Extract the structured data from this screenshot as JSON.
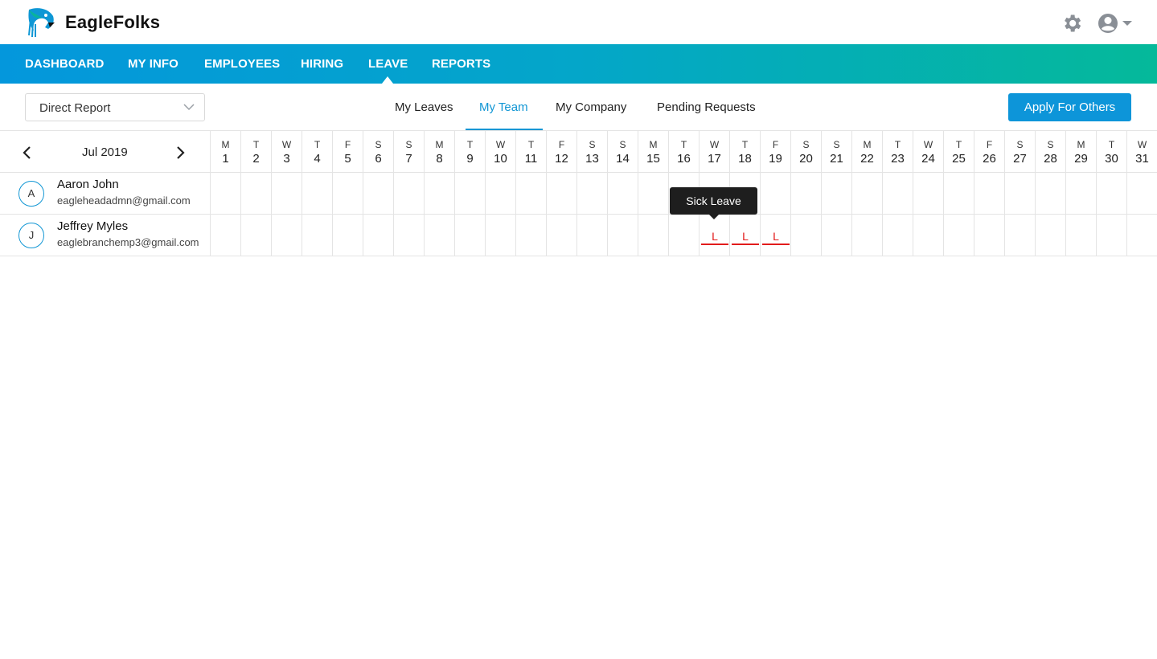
{
  "app": {
    "brand": "EagleFolks",
    "colors": {
      "accent": "#1196d4",
      "leave": "#e21b1b",
      "button": "#0d95d9"
    }
  },
  "header": {
    "icons": [
      "eagle-logo-icon",
      "gear-icon",
      "user-circle-icon",
      "caret-down-icon"
    ]
  },
  "nav": {
    "items": [
      {
        "label": "DASHBOARD"
      },
      {
        "label": "MY INFO"
      },
      {
        "label": "EMPLOYEES"
      },
      {
        "label": "HIRING"
      },
      {
        "label": "LEAVE",
        "active": true
      },
      {
        "label": "REPORTS"
      }
    ]
  },
  "filter": {
    "selected": "Direct Report"
  },
  "subtabs": {
    "items": [
      {
        "label": "My Leaves"
      },
      {
        "label": "My Team",
        "active": true
      },
      {
        "label": "My Company"
      },
      {
        "label": "Pending Requests"
      }
    ]
  },
  "actions": {
    "apply_label": "Apply For Others"
  },
  "calendar": {
    "month_label": "Jul 2019",
    "days": [
      {
        "letter": "M",
        "num": "1"
      },
      {
        "letter": "T",
        "num": "2"
      },
      {
        "letter": "W",
        "num": "3"
      },
      {
        "letter": "T",
        "num": "4"
      },
      {
        "letter": "F",
        "num": "5"
      },
      {
        "letter": "S",
        "num": "6"
      },
      {
        "letter": "S",
        "num": "7"
      },
      {
        "letter": "M",
        "num": "8"
      },
      {
        "letter": "T",
        "num": "9"
      },
      {
        "letter": "W",
        "num": "10"
      },
      {
        "letter": "T",
        "num": "11"
      },
      {
        "letter": "F",
        "num": "12"
      },
      {
        "letter": "S",
        "num": "13"
      },
      {
        "letter": "S",
        "num": "14"
      },
      {
        "letter": "M",
        "num": "15"
      },
      {
        "letter": "T",
        "num": "16"
      },
      {
        "letter": "W",
        "num": "17"
      },
      {
        "letter": "T",
        "num": "18"
      },
      {
        "letter": "F",
        "num": "19"
      },
      {
        "letter": "S",
        "num": "20"
      },
      {
        "letter": "S",
        "num": "21"
      },
      {
        "letter": "M",
        "num": "22"
      },
      {
        "letter": "T",
        "num": "23"
      },
      {
        "letter": "W",
        "num": "24"
      },
      {
        "letter": "T",
        "num": "25"
      },
      {
        "letter": "F",
        "num": "26"
      },
      {
        "letter": "S",
        "num": "27"
      },
      {
        "letter": "S",
        "num": "28"
      },
      {
        "letter": "M",
        "num": "29"
      },
      {
        "letter": "T",
        "num": "30"
      },
      {
        "letter": "W",
        "num": "31"
      }
    ]
  },
  "employees": [
    {
      "initial": "A",
      "name": "Aaron John",
      "email": "eagleheadadmn@gmail.com",
      "leaves": []
    },
    {
      "initial": "J",
      "name": "Jeffrey Myles",
      "email": "eaglebranchemp3@gmail.com",
      "leaves": [
        17,
        18,
        19
      ]
    }
  ],
  "leave_mark": "L",
  "tooltip": {
    "text": "Sick Leave"
  }
}
